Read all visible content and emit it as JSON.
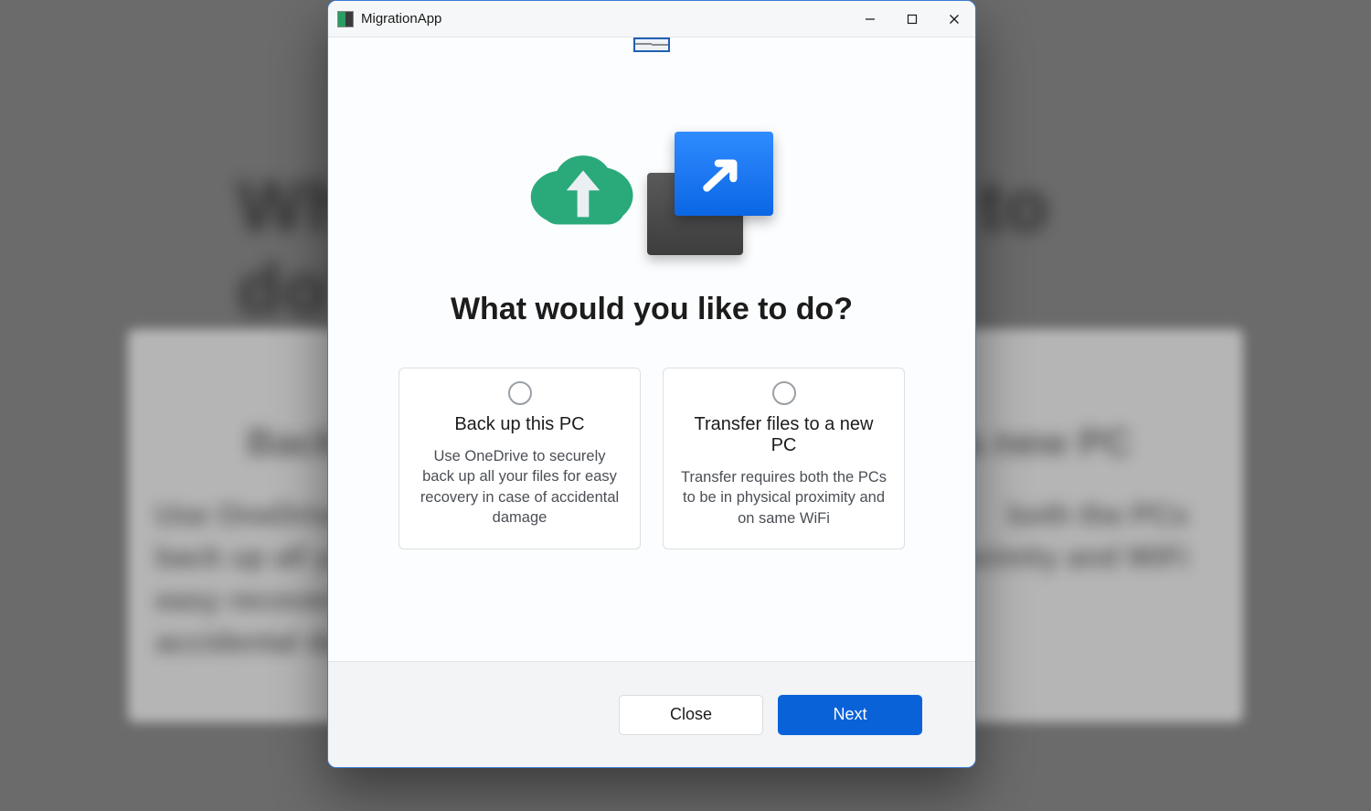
{
  "window": {
    "app_title": "MigrationApp"
  },
  "hero": {
    "heading": "What would you like to do?"
  },
  "options": {
    "backup": {
      "title": "Back up this PC",
      "description": "Use OneDrive to securely back up all your files for easy recovery in case of accidental damage"
    },
    "transfer": {
      "title": "Transfer files to a new PC",
      "description": "Transfer requires both the PCs to be in physical proximity and on same WiFi"
    }
  },
  "footer": {
    "close_label": "Close",
    "next_label": "Next"
  },
  "colors": {
    "primary_blue": "#0a62d9",
    "cloud_green": "#2aaa7a"
  }
}
